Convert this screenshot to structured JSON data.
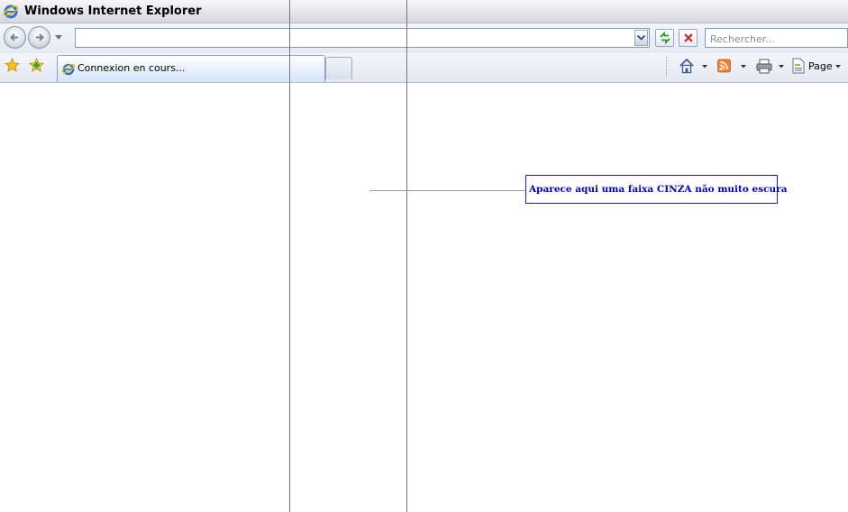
{
  "window": {
    "title": "Windows Internet Explorer"
  },
  "navigation": {
    "address_value": "",
    "search_placeholder": "Rechercher..."
  },
  "tabs": [
    {
      "label": "Connexion en cours...",
      "active": true
    }
  ],
  "command_bar": {
    "page_label": "Page"
  },
  "annotation": {
    "text": "Aparece aqui uma faixa  CINZA não muito escura",
    "color": "#0000c8",
    "border_color": "#1b1bcf"
  },
  "icons": {
    "app": "ie-logo-icon",
    "back": "back-arrow-icon",
    "forward": "forward-arrow-icon",
    "refresh": "refresh-icon",
    "stop": "stop-icon",
    "favorites": "favorites-star-icon",
    "add_favorite": "add-favorite-icon",
    "home": "home-icon",
    "feeds": "rss-feed-icon",
    "print": "printer-icon",
    "page": "page-icon"
  }
}
